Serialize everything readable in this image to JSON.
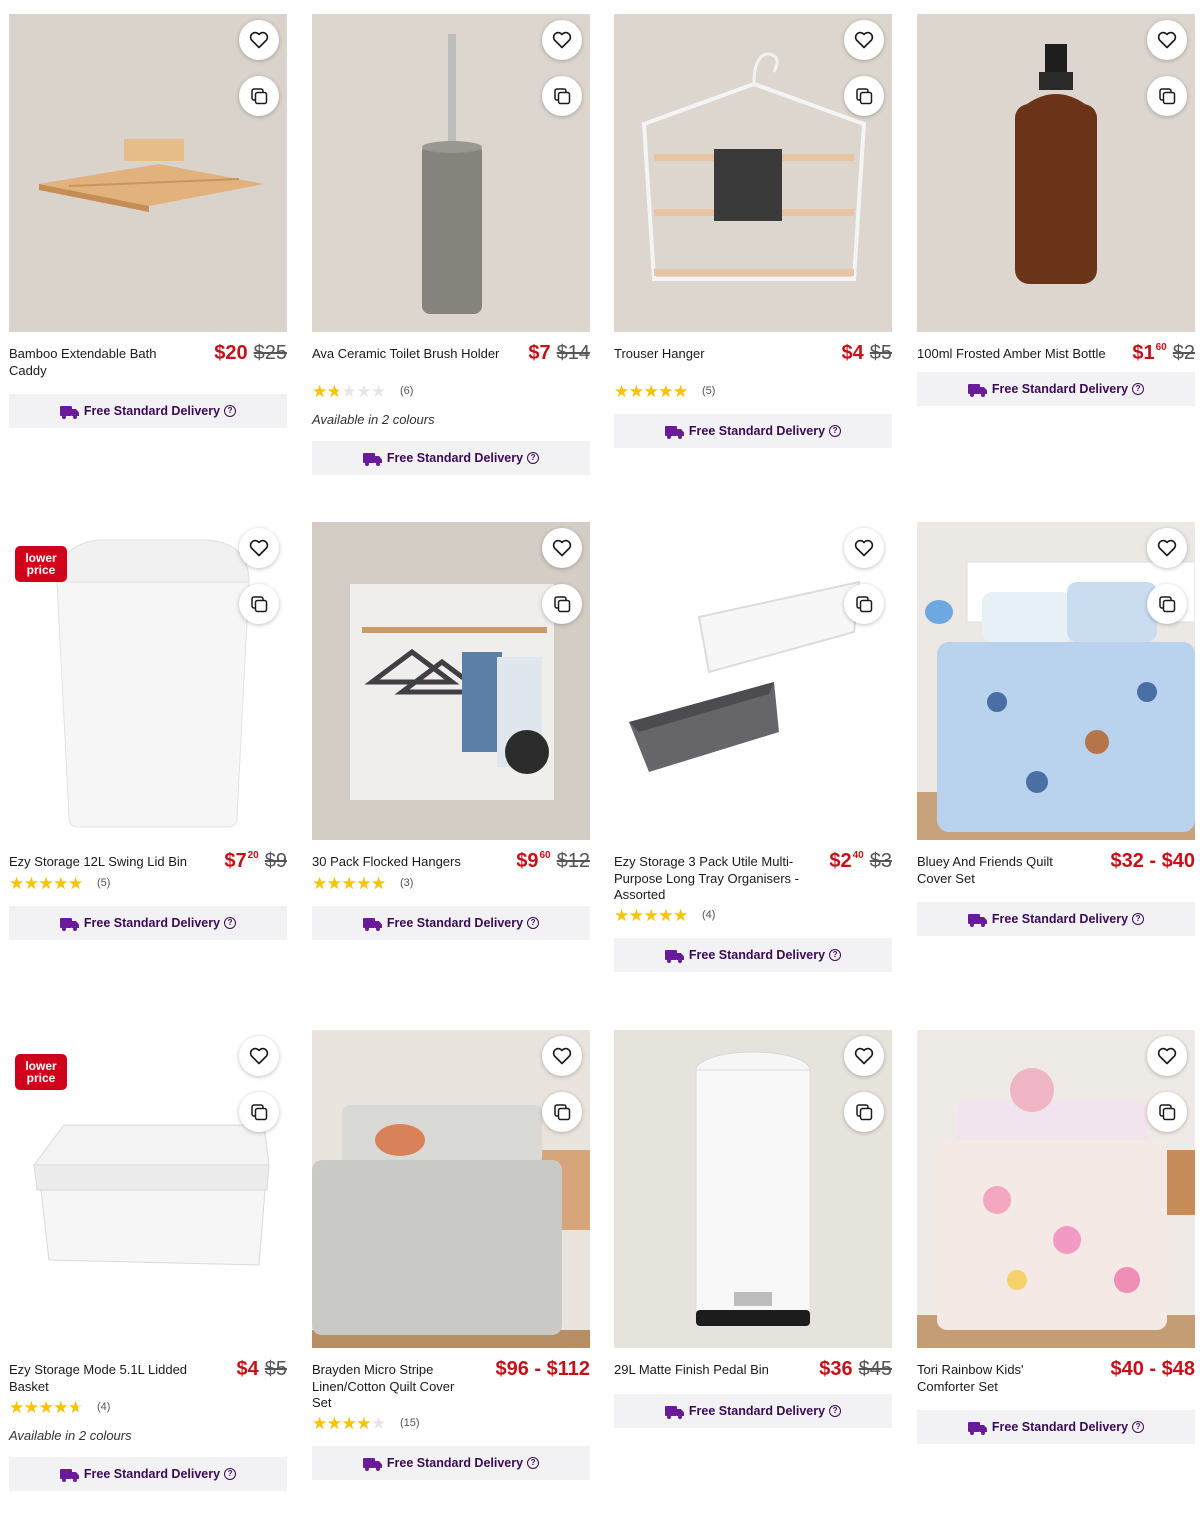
{
  "brand_colors": {
    "price_red": "#c4121a",
    "delivery_purple": "#3b0a55",
    "star_yellow": "#f6c400",
    "badge_red": "#d0021b"
  },
  "products": [
    {
      "name": "Bamboo Extendable Bath Caddy",
      "price": "$20",
      "price_cents": "",
      "was_price": "$25",
      "rating": null,
      "review_count": "",
      "colours": "",
      "badge": "",
      "delivery": "Free Standard Delivery"
    },
    {
      "name": "Ava Ceramic Toilet Brush Holder",
      "price": "$7",
      "price_cents": "",
      "was_price": "$14",
      "rating": 1.5,
      "review_count": "(6)",
      "colours": "Available in 2 colours",
      "badge": "",
      "delivery": "Free Standard Delivery"
    },
    {
      "name": "Trouser Hanger",
      "price": "$4",
      "price_cents": "",
      "was_price": "$5",
      "rating": 4.5,
      "review_count": "(5)",
      "colours": "",
      "badge": "",
      "delivery": "Free Standard Delivery"
    },
    {
      "name": "100ml Frosted Amber Mist Bottle",
      "price": "$1",
      "price_cents": "60",
      "was_price": "$2",
      "rating": null,
      "review_count": "",
      "colours": "",
      "badge": "",
      "delivery": "Free Standard Delivery"
    },
    {
      "name": "Ezy Storage 12L Swing Lid Bin",
      "price": "$7",
      "price_cents": "20",
      "was_price": "$9",
      "rating": 5,
      "review_count": "(5)",
      "colours": "",
      "badge": "lower price",
      "delivery": "Free Standard Delivery"
    },
    {
      "name": "30 Pack Flocked Hangers",
      "price": "$9",
      "price_cents": "60",
      "was_price": "$12",
      "rating": 5,
      "review_count": "(3)",
      "colours": "",
      "badge": "",
      "delivery": "Free Standard Delivery"
    },
    {
      "name": "Ezy Storage 3 Pack Utile Multi-Purpose Long Tray Organisers - Assorted",
      "price": "$2",
      "price_cents": "40",
      "was_price": "$3",
      "rating": 5,
      "review_count": "(4)",
      "colours": "",
      "badge": "",
      "delivery": "Free Standard Delivery"
    },
    {
      "name": "Bluey And Friends Quilt Cover Set",
      "price": "$32 - $40",
      "price_cents": "",
      "was_price": "",
      "rating": null,
      "review_count": "",
      "colours": "",
      "badge": "",
      "delivery": "Free Standard Delivery"
    },
    {
      "name": "Ezy Storage Mode 5.1L Lidded Basket",
      "price": "$4",
      "price_cents": "",
      "was_price": "$5",
      "rating": 4,
      "review_count": "(4)",
      "colours": "Available in 2 colours",
      "badge": "lower price",
      "delivery": "Free Standard Delivery"
    },
    {
      "name": "Brayden Micro Stripe Linen/Cotton Quilt Cover Set",
      "price": "$96 - $112",
      "price_cents": "",
      "was_price": "",
      "rating": 3.5,
      "review_count": "(15)",
      "colours": "",
      "badge": "",
      "delivery": "Free Standard Delivery"
    },
    {
      "name": "29L Matte Finish Pedal Bin",
      "price": "$36",
      "price_cents": "",
      "was_price": "$45",
      "rating": null,
      "review_count": "",
      "colours": "",
      "badge": "",
      "delivery": "Free Standard Delivery"
    },
    {
      "name": "Tori Rainbow Kids' Comforter Set",
      "price": "$40 - $48",
      "price_cents": "",
      "was_price": "",
      "rating": null,
      "review_count": "",
      "colours": "",
      "badge": "",
      "delivery": "Free Standard Delivery"
    }
  ]
}
